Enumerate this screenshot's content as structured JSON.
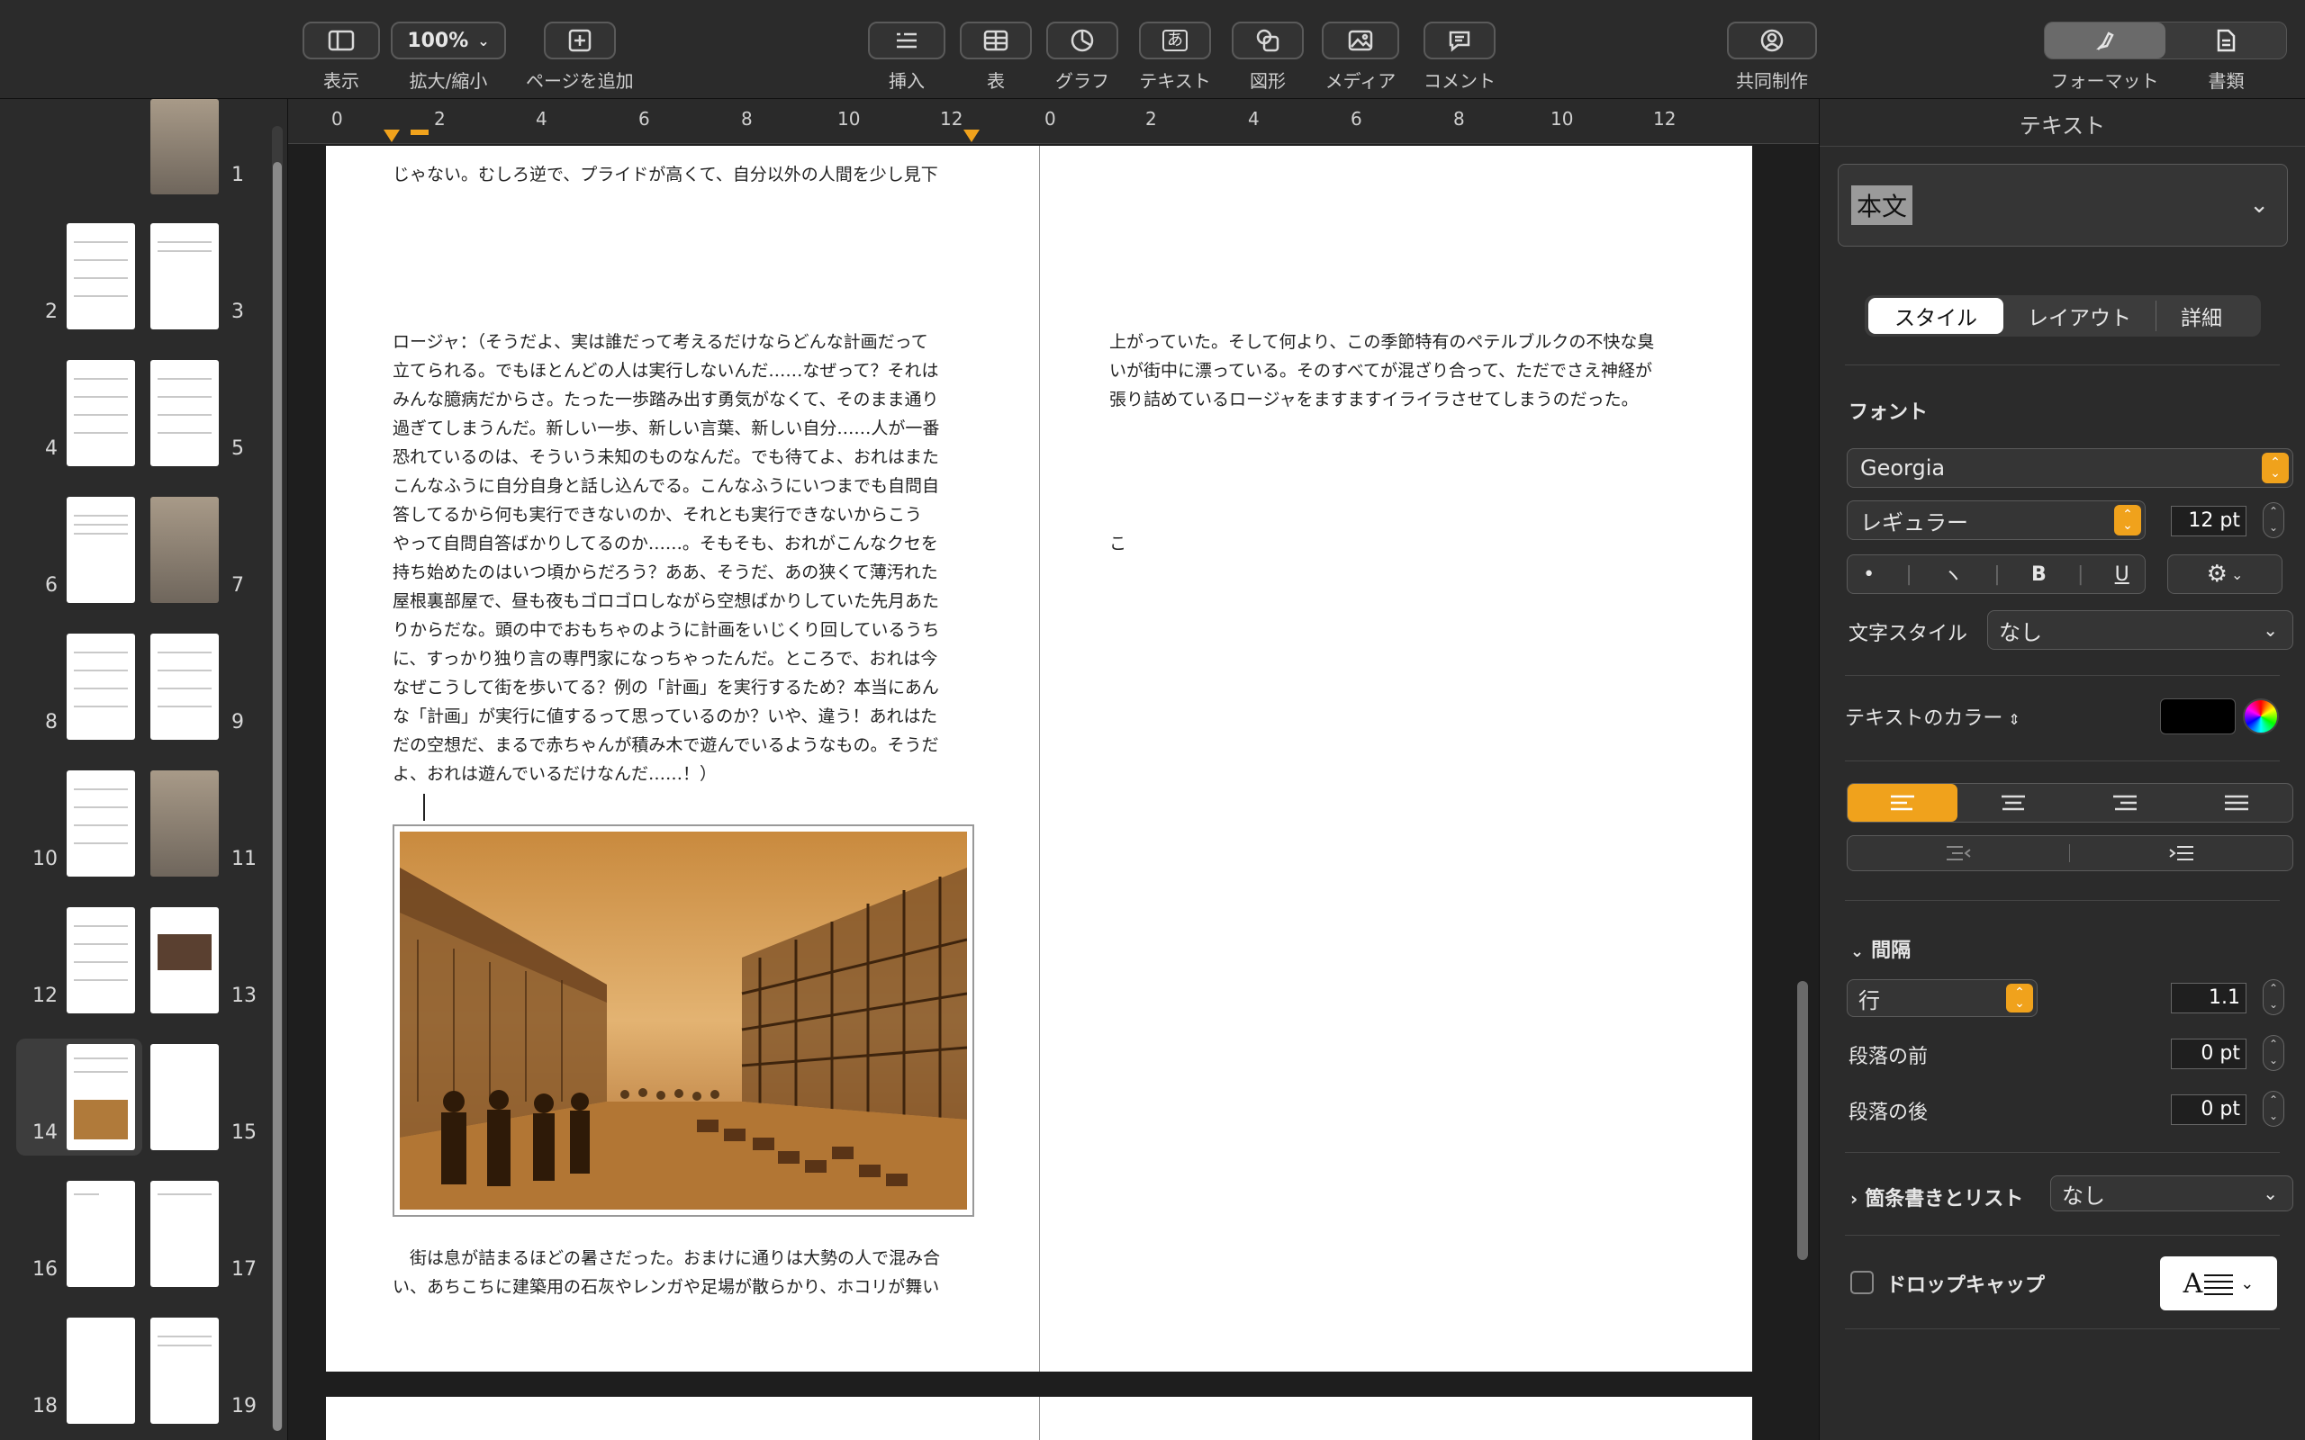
{
  "toolbar": {
    "view_label": "表示",
    "zoom_value": "100%",
    "zoom_label": "拡大/縮小",
    "add_page_label": "ページを追加",
    "insert_label": "挿入",
    "table_label": "表",
    "chart_label": "グラフ",
    "text_label": "テキスト",
    "shape_label": "図形",
    "media_label": "メディア",
    "comment_label": "コメント",
    "collab_label": "共同制作",
    "format_label": "フォーマット",
    "document_label": "書類"
  },
  "sidebar": {
    "pages": [
      "1",
      "2",
      "3",
      "4",
      "5",
      "6",
      "7",
      "8",
      "9",
      "10",
      "11",
      "12",
      "13",
      "14",
      "15",
      "16",
      "17",
      "18",
      "19"
    ],
    "selected_page": "14"
  },
  "ruler": {
    "left_numbers": [
      "0",
      "2",
      "4",
      "6",
      "8",
      "10",
      "12"
    ],
    "right_numbers": [
      "0",
      "2",
      "4",
      "6",
      "8",
      "10",
      "12"
    ]
  },
  "document": {
    "top_left_line": "じゃない。むしろ逆で、プライドが高くて、自分以外の人間を少し見下",
    "left_paragraph": "ロージャ：（そうだよ、実は誰だって考えるだけならどんな計画だって\n立てられる。でもほとんどの人は実行しないんだ……なぜって？それは\nみんな臆病だからさ。たった一歩踏み出す勇気がなくて、そのまま通り\n過ぎてしまうんだ。新しい一歩、新しい言葉、新しい自分……人が一番\n恐れているのは、そういう未知のものなんだ。でも待てよ、おれはまた\nこんなふうに自分自身と話し込んでる。こんなふうにいつまでも自問自\n答してるから何も実行できないのか、それとも実行できないからこう\nやって自問自答ばかりしてるのか……。そもそも、おれがこんなクセを\n持ち始めたのはいつ頃からだろう？ああ、そうだ、あの狭くて薄汚れた\n屋根裏部屋で、昼も夜もゴロゴロしながら空想ばかりしていた先月あた\nりからだな。頭の中でおもちゃのように計画をいじくり回しているうち\nに、すっかり独り言の専門家になっちゃったんだ。ところで、おれは今\nなぜこうして街を歩いてる？例の「計画」を実行するため？本当にあん\nな「計画」が実行に値するって思っているのか？いや、違う！あれはた\nだの空想だ、まるで赤ちゃんが積み木で遊んでいるようなもの。そうだ\nよ、おれは遊んでいるだけなんだ……！）",
    "bottom_left": "　街は息が詰まるほどの暑さだった。おまけに通りは大勢の人で混み合\nい、あちこちに建築用の石灰やレンガや足場が散らかり、ホコリが舞い",
    "right_paragraph": "上がっていた。そして何より、この季節特有のペテルブルクの不快な臭\nいが街中に漂っている。そのすべてが混ざり合って、ただでさえ神経が\n張り詰めているロージャをますますイライラさせてしまうのだった。",
    "right_char": "こ"
  },
  "inspector": {
    "title": "テキスト",
    "paragraph_style": "本文",
    "tabs": [
      "スタイル",
      "レイアウト",
      "詳細"
    ],
    "font_section": "フォント",
    "font_name": "Georgia",
    "font_weight": "レギュラー",
    "font_size": "12 pt",
    "char_style_label": "文字スタイル",
    "char_style_value": "なし",
    "text_color_label": "テキストのカラー",
    "spacing_label": "間隔",
    "line_label": "行",
    "line_value": "1.1",
    "before_label": "段落の前",
    "before_value": "0 pt",
    "after_label": "段落の後",
    "after_value": "0 pt",
    "bullets_label": "箇条書きとリスト",
    "bullets_value": "なし",
    "dropcap_label": "ドロップキャップ"
  },
  "colors": {
    "accent": "#f0a21c",
    "text_color": "#000000"
  }
}
